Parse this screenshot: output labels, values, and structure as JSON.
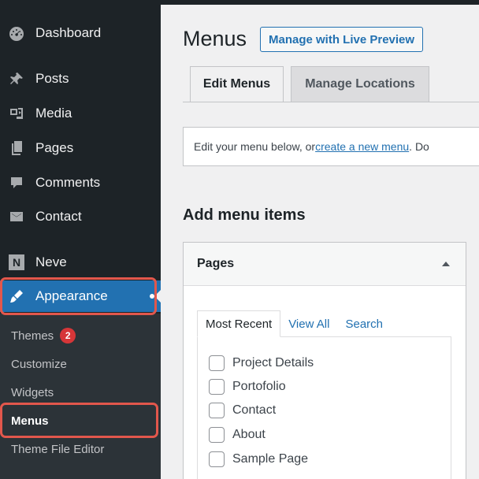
{
  "sidebar": {
    "items": [
      {
        "label": "Dashboard",
        "icon": "dashboard-icon"
      },
      {
        "label": "Posts",
        "icon": "pin-icon"
      },
      {
        "label": "Media",
        "icon": "media-icon"
      },
      {
        "label": "Pages",
        "icon": "pages-icon"
      },
      {
        "label": "Comments",
        "icon": "comment-icon"
      },
      {
        "label": "Contact",
        "icon": "envelope-icon"
      },
      {
        "label": "Neve",
        "icon": "neve-logo-icon",
        "icon_text": "N"
      },
      {
        "label": "Appearance",
        "icon": "brush-icon"
      }
    ],
    "submenu": [
      {
        "label": "Themes",
        "badge": "2"
      },
      {
        "label": "Customize"
      },
      {
        "label": "Widgets"
      },
      {
        "label": "Menus"
      },
      {
        "label": "Theme File Editor"
      }
    ]
  },
  "main": {
    "title": "Menus",
    "live_preview_label": "Manage with Live Preview",
    "tabs": [
      {
        "label": "Edit Menus"
      },
      {
        "label": "Manage Locations"
      }
    ],
    "notice": {
      "text_before": "Edit your menu below, or ",
      "link": "create a new menu",
      "text_after": ". Do"
    },
    "section_title": "Add menu items",
    "accordion": {
      "title": "Pages",
      "inner_tabs": [
        "Most Recent",
        "View All",
        "Search"
      ],
      "pages": [
        "Project Details",
        "Portofolio",
        "Contact",
        "About",
        "Sample Page"
      ]
    }
  },
  "colors": {
    "sidebar_bg": "#1d2327",
    "submenu_bg": "#2c3338",
    "accent": "#2271b1",
    "highlight": "#e2574c",
    "badge": "#d63638"
  }
}
